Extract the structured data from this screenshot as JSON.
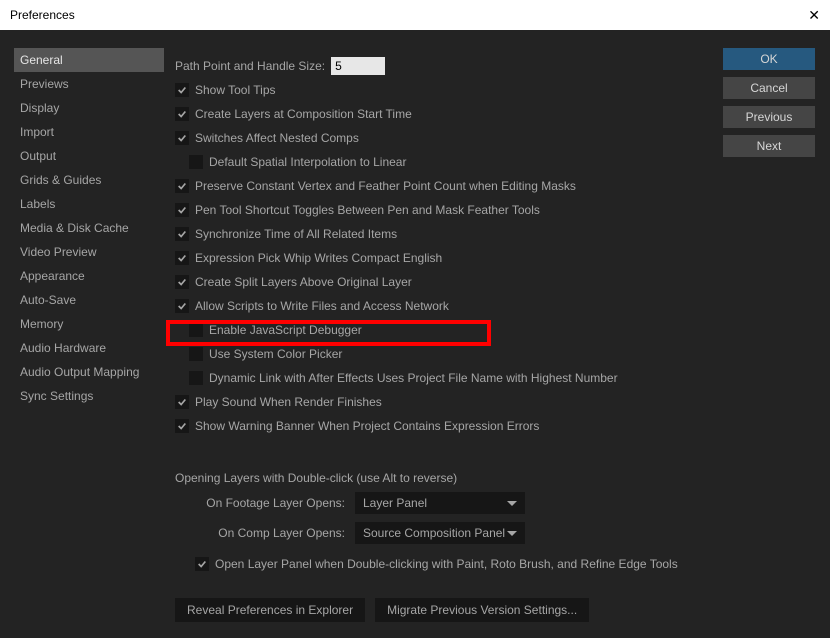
{
  "window_title": "Preferences",
  "sidebar": {
    "items": [
      "General",
      "Previews",
      "Display",
      "Import",
      "Output",
      "Grids & Guides",
      "Labels",
      "Media & Disk Cache",
      "Video Preview",
      "Appearance",
      "Auto-Save",
      "Memory",
      "Audio Hardware",
      "Audio Output Mapping",
      "Sync Settings"
    ],
    "selected_index": 0
  },
  "buttons": {
    "ok": "OK",
    "cancel": "Cancel",
    "previous": "Previous",
    "next": "Next"
  },
  "path_point_label": "Path Point and Handle Size:",
  "path_point_value": "5",
  "checks": [
    {
      "on": true,
      "label": "Show Tool Tips",
      "indent": false
    },
    {
      "on": true,
      "label": "Create Layers at Composition Start Time",
      "indent": false
    },
    {
      "on": true,
      "label": "Switches Affect Nested Comps",
      "indent": false
    },
    {
      "on": false,
      "label": "Default Spatial Interpolation to Linear",
      "indent": true
    },
    {
      "on": true,
      "label": "Preserve Constant Vertex and Feather Point Count when Editing Masks",
      "indent": false
    },
    {
      "on": true,
      "label": "Pen Tool Shortcut Toggles Between Pen and Mask Feather Tools",
      "indent": false
    },
    {
      "on": true,
      "label": "Synchronize Time of All Related Items",
      "indent": false
    },
    {
      "on": true,
      "label": "Expression Pick Whip Writes Compact English",
      "indent": false
    },
    {
      "on": true,
      "label": "Create Split Layers Above Original Layer",
      "indent": false
    },
    {
      "on": true,
      "label": "Allow Scripts to Write Files and Access Network",
      "indent": false
    },
    {
      "on": false,
      "label": "Enable JavaScript Debugger",
      "indent": true
    },
    {
      "on": false,
      "label": "Use System Color Picker",
      "indent": true
    },
    {
      "on": false,
      "label": "Dynamic Link with After Effects Uses Project File Name with Highest Number",
      "indent": true
    },
    {
      "on": true,
      "label": "Play Sound When Render Finishes",
      "indent": false
    },
    {
      "on": true,
      "label": "Show Warning Banner When Project Contains Expression Errors",
      "indent": false
    }
  ],
  "group": {
    "title": "Opening Layers with Double-click (use Alt to reverse)",
    "footage_label": "On Footage Layer Opens:",
    "footage_value": "Layer Panel",
    "comp_label": "On Comp Layer Opens:",
    "comp_value": "Source Composition Panel",
    "open_panel_check_on": true,
    "open_panel_check_label": "Open Layer Panel when Double-clicking with Paint, Roto Brush, and Refine Edge Tools"
  },
  "bottom": {
    "reveal": "Reveal Preferences in Explorer",
    "migrate": "Migrate Previous Version Settings..."
  }
}
